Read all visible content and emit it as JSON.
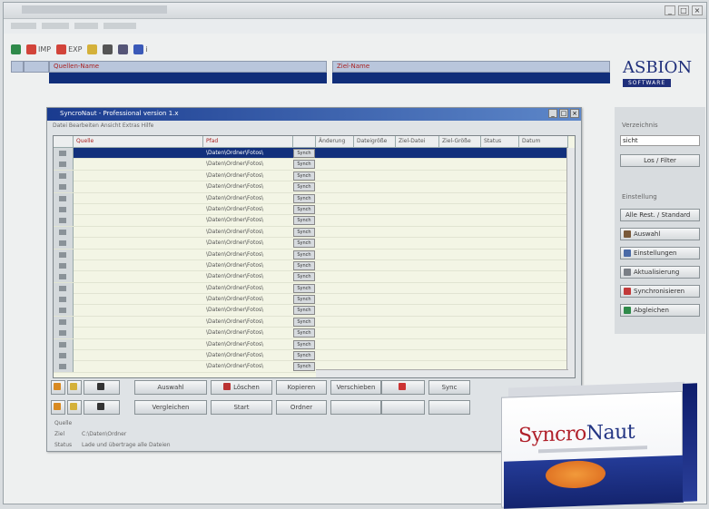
{
  "window": {
    "title_controls": [
      "_",
      "□",
      "×"
    ]
  },
  "toolbar": {
    "items": [
      "IMP",
      "EXP",
      "",
      "",
      "",
      "",
      "i"
    ]
  },
  "header": {
    "col1": "Quellen-Name",
    "col2": "Ziel-Name"
  },
  "logo": {
    "line1": "ASBION",
    "line2": "SOFTWARE"
  },
  "right_panel": {
    "label": "Verzeichnis",
    "input_value": "sicht",
    "search_button": "Los / Filter",
    "group_label": "Einstellung",
    "buttons": [
      "Alle Rest. / Standard",
      "Auswahl",
      "Einstellungen",
      "Aktualisierung",
      "Synchronisieren",
      "Abgleichen"
    ]
  },
  "dialog": {
    "title": "SyncroNaut - Professional version 1.x",
    "menu": "Datei  Bearbeiten  Ansicht  Extras  Hilfe",
    "columns": [
      "Quelle",
      "Pfad",
      "",
      "Änderung",
      "Dateigröße",
      "Ziel-Datei",
      "Ziel-Größe",
      "Status",
      "Datum"
    ],
    "rows": [
      {
        "path": "\\Daten\\Ordner\\Fotos\\",
        "btn": "Synch"
      },
      {
        "path": "\\Daten\\Ordner\\Fotos\\",
        "btn": "Synch"
      },
      {
        "path": "\\Daten\\Ordner\\Fotos\\",
        "btn": "Synch"
      },
      {
        "path": "\\Daten\\Ordner\\Fotos\\",
        "btn": "Synch"
      },
      {
        "path": "\\Daten\\Ordner\\Fotos\\",
        "btn": "Synch"
      },
      {
        "path": "\\Daten\\Ordner\\Fotos\\",
        "btn": "Synch"
      },
      {
        "path": "\\Daten\\Ordner\\Fotos\\",
        "btn": "Synch"
      },
      {
        "path": "\\Daten\\Ordner\\Fotos\\",
        "btn": "Synch"
      },
      {
        "path": "\\Daten\\Ordner\\Fotos\\",
        "btn": "Synch"
      },
      {
        "path": "\\Daten\\Ordner\\Fotos\\",
        "btn": "Synch"
      },
      {
        "path": "\\Daten\\Ordner\\Fotos\\",
        "btn": "Synch"
      },
      {
        "path": "\\Daten\\Ordner\\Fotos\\",
        "btn": "Synch"
      },
      {
        "path": "\\Daten\\Ordner\\Fotos\\",
        "btn": "Synch"
      },
      {
        "path": "\\Daten\\Ordner\\Fotos\\",
        "btn": "Synch"
      },
      {
        "path": "\\Daten\\Ordner\\Fotos\\",
        "btn": "Synch"
      },
      {
        "path": "\\Daten\\Ordner\\Fotos\\",
        "btn": "Synch"
      },
      {
        "path": "\\Daten\\Ordner\\Fotos\\",
        "btn": "Synch"
      },
      {
        "path": "\\Daten\\Ordner\\Fotos\\",
        "btn": "Synch"
      },
      {
        "path": "\\Daten\\Ordner\\Fotos\\",
        "btn": "Synch"
      },
      {
        "path": "\\Daten\\Ordner\\Fotos\\",
        "btn": "Synch"
      }
    ],
    "buttons_row1": [
      "Auswahl",
      "Löschen",
      "Kopieren",
      "Verschieben",
      "Sync"
    ],
    "buttons_row2": [
      "Vergleichen",
      "Start",
      "Ordner"
    ],
    "status_labels": [
      "Quelle",
      "Ziel",
      "Status"
    ],
    "status_values": [
      "",
      "C:\\Daten\\Ordner",
      "Lade und übertrage alle Dateien"
    ]
  },
  "box": {
    "brand_part1": "Syncro",
    "brand_part2": "Naut"
  }
}
